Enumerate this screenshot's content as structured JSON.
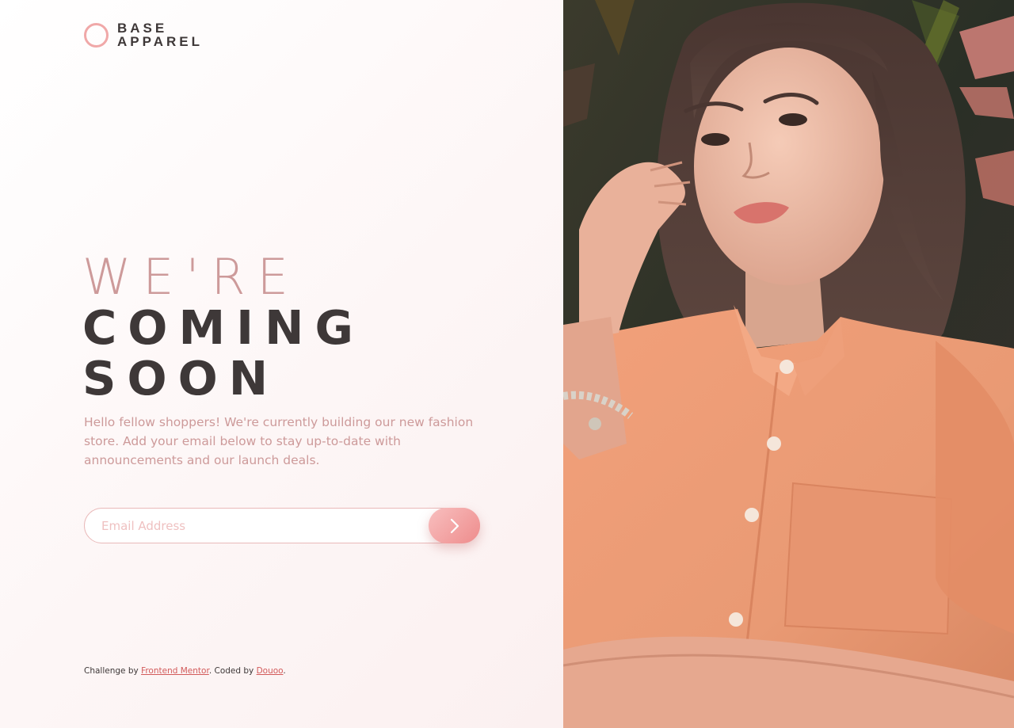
{
  "brand": {
    "line1": "BASE",
    "line2": "APPAREL"
  },
  "hero": {
    "line1": "WE'RE",
    "line2": "COMING",
    "line3": "SOON",
    "description": "Hello fellow shoppers! We're currently building our new fashion store. Add your email below to stay up-to-date with announcements and our launch deals."
  },
  "form": {
    "placeholder": "Email Address",
    "value": ""
  },
  "footer": {
    "prefix": "Challenge by ",
    "link1": "Frontend Mentor",
    "middle": ". Coded by ",
    "link2": "Douoo",
    "suffix": "."
  },
  "colors": {
    "accent": "#f0a8a8",
    "text_dark": "#3e3838",
    "text_pink": "#cd9a9a",
    "link": "#d25a5a"
  }
}
